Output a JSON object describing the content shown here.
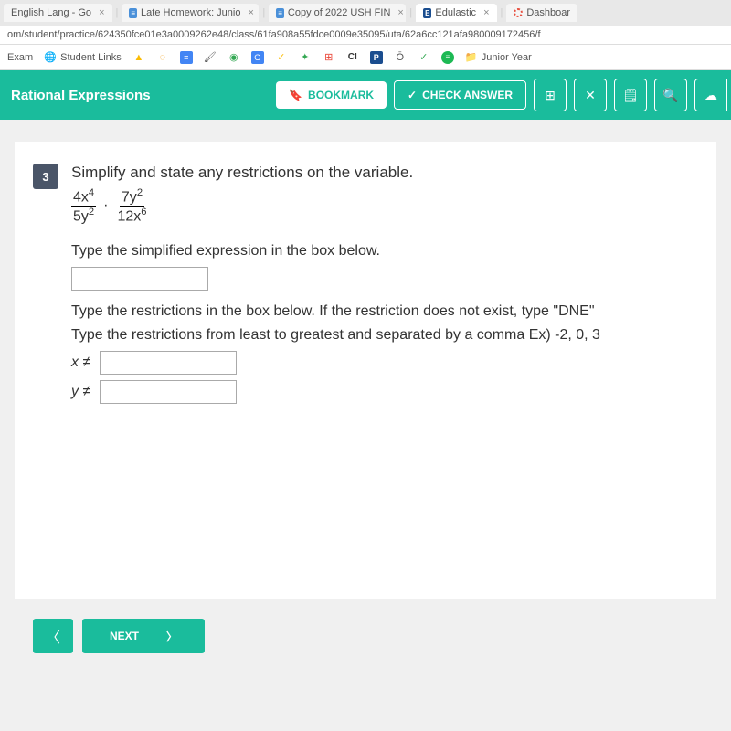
{
  "tabs": [
    {
      "label": "English Lang - Go",
      "icon": ""
    },
    {
      "label": "Late Homework: Junio",
      "icon": "et"
    },
    {
      "label": "Copy of 2022 USH FIN",
      "icon": "et"
    },
    {
      "label": "Edulastic",
      "icon": "ed"
    },
    {
      "label": "Dashboar",
      "icon": "canvas"
    }
  ],
  "url": "om/student/practice/624350fce01e3a0009262e48/class/61fa908a55fdce0009e35095/uta/62a6cc121afa980009172456/f",
  "bookmarks": {
    "exam": "Exam",
    "student_links": "Student Links",
    "junior_year": "Junior Year"
  },
  "header": {
    "title": "Rational Expressions",
    "bookmark_label": "BOOKMARK",
    "check_answer_label": "CHECK ANSWER"
  },
  "question": {
    "number": "3",
    "prompt": "Simplify and state any restrictions on the variable.",
    "frac1_num": "4x",
    "frac1_num_exp": "4",
    "frac1_den": "5y",
    "frac1_den_exp": "2",
    "frac2_num": "7y",
    "frac2_num_exp": "2",
    "frac2_den": "12x",
    "frac2_den_exp": "6",
    "instruction1": "Type the simplified expression in the box below.",
    "instruction2": "Type the restrictions in the box below. If the restriction does not exist, type \"DNE\"",
    "instruction3": "Type the restrictions from least to greatest and separated by a comma Ex) -2, 0, 3",
    "x_label": "x ≠",
    "y_label": "y ≠"
  },
  "nav": {
    "next": "NEXT"
  }
}
